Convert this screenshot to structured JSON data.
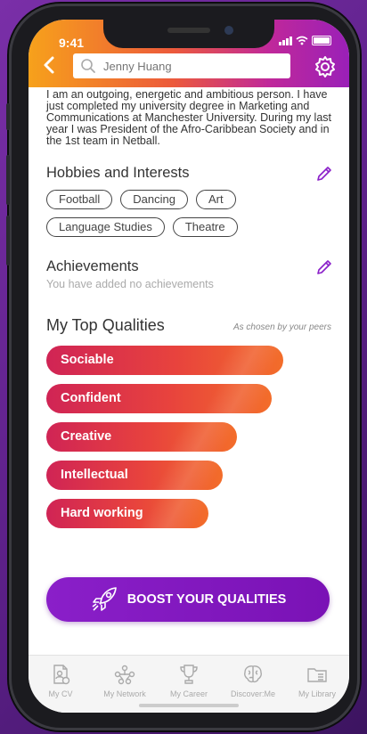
{
  "status_bar": {
    "time": "9:41"
  },
  "header": {
    "search_placeholder": "Jenny Huang"
  },
  "bio": "I am an outgoing, energetic and ambitious person. I have just completed my university degree in Marketing and Communications at Manchester University. During my last year I was President of the Afro-Caribbean Society and in the 1st team in Netball.",
  "hobbies": {
    "title": "Hobbies and Interests",
    "items": [
      "Football",
      "Dancing",
      "Art",
      "Language Studies",
      "Theatre"
    ]
  },
  "achievements": {
    "title": "Achievements",
    "empty_text": "You have added no achievements"
  },
  "qualities": {
    "title": "My Top Qualities",
    "note": "As chosen by your peers",
    "items": [
      {
        "label": "Sociable",
        "level": 0.83
      },
      {
        "label": "Confident",
        "level": 0.79
      },
      {
        "label": "Creative",
        "level": 0.67
      },
      {
        "label": "Intellectual",
        "level": 0.62
      },
      {
        "label": "Hard working",
        "level": 0.57
      }
    ]
  },
  "boost_button": {
    "label": "BOOST YOUR QUALITIES"
  },
  "tabs": [
    {
      "label": "My CV",
      "icon": "cv-icon"
    },
    {
      "label": "My Network",
      "icon": "network-icon"
    },
    {
      "label": "My Career",
      "icon": "trophy-icon"
    },
    {
      "label": "Discover:Me",
      "icon": "brain-icon"
    },
    {
      "label": "My Library",
      "icon": "folder-icon"
    }
  ],
  "colors": {
    "header_gradient": [
      "#f7a11b",
      "#ec5a3b",
      "#c0289a",
      "#9a20b8"
    ],
    "accent_purple": "#8a1fc9",
    "quality_bar": [
      "#d02455",
      "#f36d2a"
    ]
  }
}
